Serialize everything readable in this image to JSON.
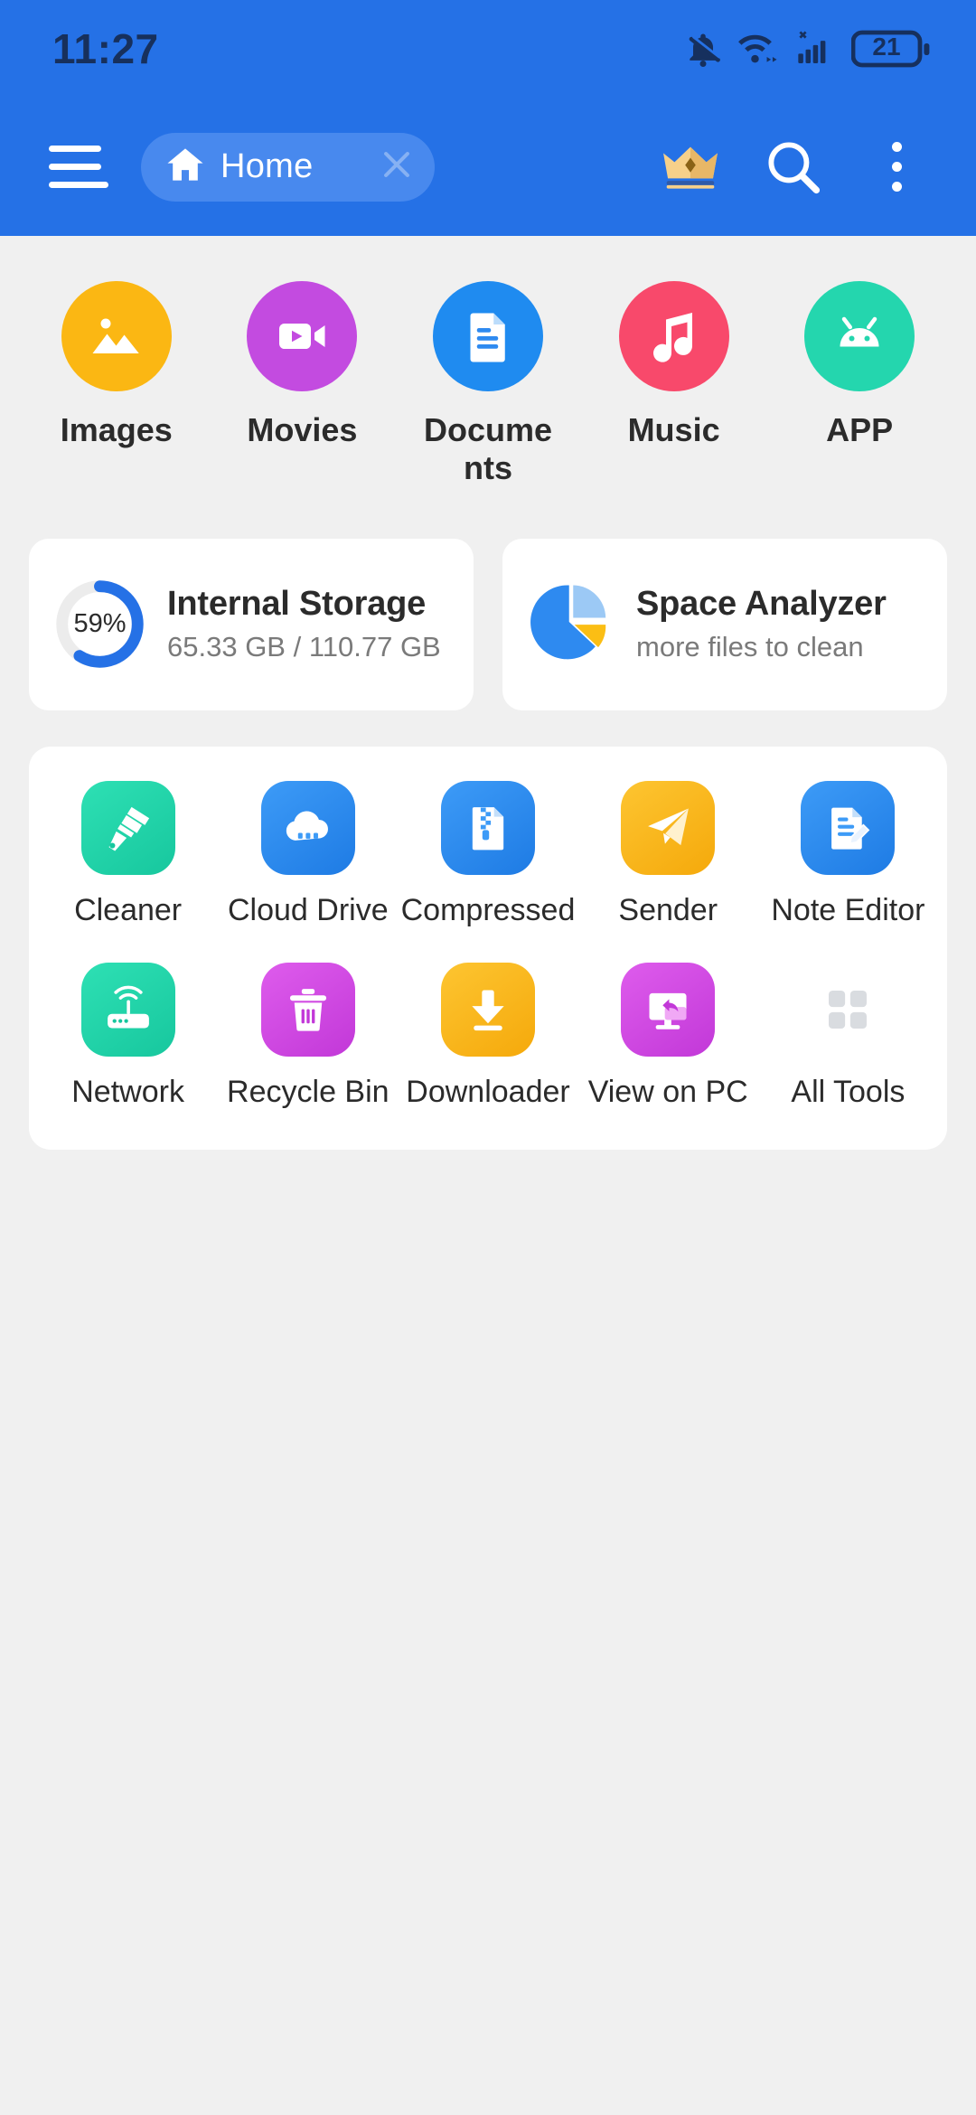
{
  "status_bar": {
    "time": "11:27",
    "battery_level": "21",
    "icons": [
      "bell-mute-icon",
      "wifi-icon",
      "cell-signal-no-service-icon",
      "battery-icon"
    ]
  },
  "toolbar": {
    "menu_icon": "hamburger-menu-icon",
    "tab": {
      "label": "Home",
      "home_icon": "home-icon",
      "close_icon": "close-icon"
    },
    "premium_icon": "crown-icon",
    "search_icon": "search-icon",
    "overflow_icon": "more-vertical-icon"
  },
  "categories": [
    {
      "label": "Images",
      "icon": "image-icon",
      "color": "#FBB713"
    },
    {
      "label": "Movies",
      "icon": "video-icon",
      "color": "#C34BE0"
    },
    {
      "label": "Documents",
      "icon": "document-icon",
      "color": "#1F8BF0"
    },
    {
      "label": "Music",
      "icon": "music-note-icon",
      "color": "#F8496B"
    },
    {
      "label": "APP",
      "icon": "android-icon",
      "color": "#24D6AE"
    }
  ],
  "storage": {
    "internal": {
      "title": "Internal Storage",
      "usage": "65.33 GB / 110.77 GB",
      "percent_label": "59%",
      "percent": 59,
      "accent": "#2571E6",
      "track": "#ECECEC"
    },
    "analyzer": {
      "title": "Space Analyzer",
      "subtitle": "more files to clean",
      "icon": "pie-chart-icon",
      "colors": {
        "primary": "#2E8AF0",
        "secondary": "#9CC9F5",
        "accent": "#FBBE14"
      }
    }
  },
  "tools": [
    [
      {
        "label": "Cleaner",
        "icon": "brush-icon",
        "color": "#24D6AE"
      },
      {
        "label": "Cloud Drive",
        "icon": "cloud-icon",
        "color": "#2E8AF0"
      },
      {
        "label": "Compressed",
        "icon": "zip-file-icon",
        "color": "#2E8AF0"
      },
      {
        "label": "Sender",
        "icon": "paper-plane-icon",
        "color": "#FBB713"
      },
      {
        "label": "Note Editor",
        "icon": "note-edit-icon",
        "color": "#2E8AF0"
      }
    ],
    [
      {
        "label": "Network",
        "icon": "router-icon",
        "color": "#24D6AE"
      },
      {
        "label": "Recycle Bin",
        "icon": "trash-icon",
        "color": "#D24BE0"
      },
      {
        "label": "Downloader",
        "icon": "download-icon",
        "color": "#FBB713"
      },
      {
        "label": "View on PC",
        "icon": "monitor-icon",
        "color": "#D24BE0"
      },
      {
        "label": "All Tools",
        "icon": "grid-icon",
        "color": "#FFFFFF"
      }
    ]
  ]
}
